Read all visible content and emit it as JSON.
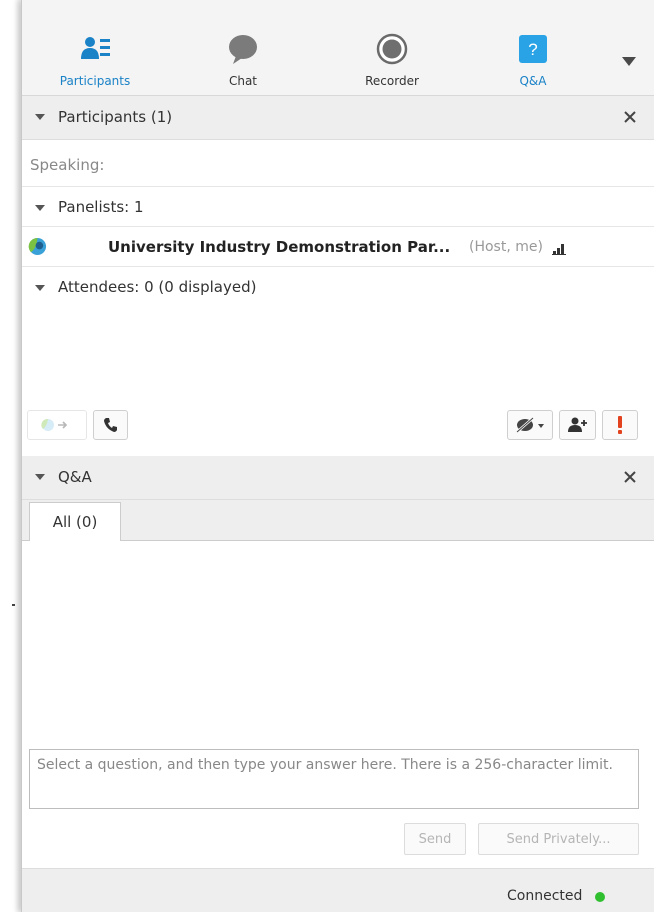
{
  "toolbar": {
    "participants_label": "Participants",
    "chat_label": "Chat",
    "recorder_label": "Recorder",
    "qa_label": "Q&A",
    "qa_icon_text": "?",
    "more_icon": "triangle-down-icon"
  },
  "participants_panel": {
    "title": "Participants (1)",
    "speaking_label": "Speaking:",
    "panelists_label": "Panelists: 1",
    "panelist": {
      "name": "University Industry Demonstration Par...",
      "role": "(Host, me)"
    },
    "attendees_label": "Attendees: 0 (0 displayed)"
  },
  "qa_panel": {
    "title": "Q&A",
    "tabs": [
      {
        "label": "All (0)"
      }
    ],
    "answer_placeholder": "Select a question, and then type your answer here. There is a 256-character limit.",
    "send_label": "Send",
    "send_privately_label": "Send Privately..."
  },
  "status": {
    "text": "Connected",
    "dot_color": "#2fbf2f"
  },
  "colors": {
    "accent": "#1a82c7",
    "header_bg": "#eeeeee",
    "alert": "#e2421e"
  }
}
